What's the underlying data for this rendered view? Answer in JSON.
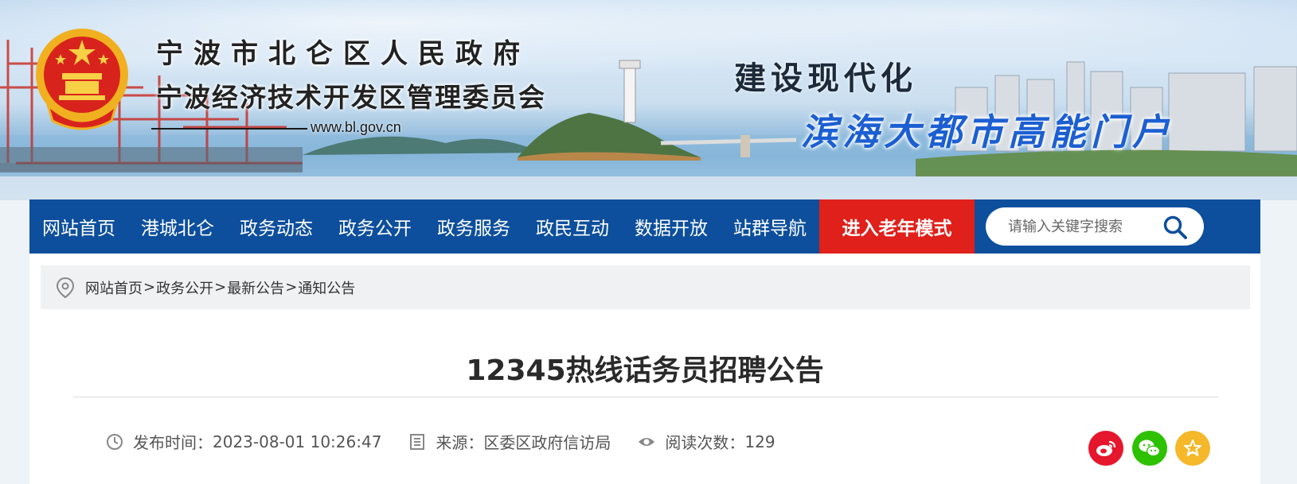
{
  "header": {
    "gov_name": "宁波市北仑区人民政府",
    "gov_subtitle": "宁波经济技术开发区管理委员会",
    "url": "www.bl.gov.cn",
    "slogan_line1": "建设现代化",
    "slogan_line2": "滨海大都市高能门户"
  },
  "nav": {
    "items": [
      "网站首页",
      "港城北仑",
      "政务动态",
      "政务公开",
      "政务服务",
      "政民互动",
      "数据开放",
      "站群导航"
    ],
    "elder_mode": "进入老年模式",
    "search_placeholder": "请输入关键字搜索"
  },
  "breadcrumb": {
    "items": [
      "网站首页",
      "政务公开",
      "最新公告",
      "通知公告"
    ],
    "separator": ">"
  },
  "article": {
    "title": "12345热线话务员招聘公告",
    "publish_label": "发布时间：",
    "publish_time": "2023-08-01 10:26:47",
    "source_label": "来源：",
    "source": "区委区政府信访局",
    "views_label": "阅读次数：",
    "views": "129"
  },
  "share": {
    "icons": [
      "weibo-icon",
      "wechat-icon",
      "favorite-star-icon"
    ]
  },
  "colors": {
    "nav_bg": "#0d4f9c",
    "elder_bg": "#e0201b",
    "weibo": "#e6162d",
    "wechat": "#2dc100",
    "favorite": "#f5b82a"
  }
}
